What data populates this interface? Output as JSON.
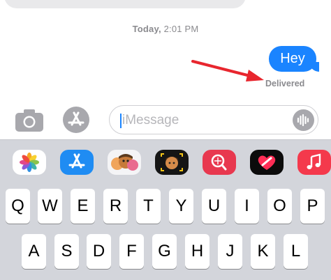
{
  "conversation": {
    "timestamp_day": "Today,",
    "timestamp_time": "2:01 PM",
    "sent_message": "Hey",
    "delivery_status": "Delivered"
  },
  "composer": {
    "placeholder": "iMessage"
  },
  "app_strip": {
    "apps": [
      {
        "icon": "photos-icon"
      },
      {
        "icon": "app-store-icon"
      },
      {
        "icon": "memoji-stickers-icon"
      },
      {
        "icon": "animoji-icon"
      },
      {
        "icon": "images-search-icon"
      },
      {
        "icon": "digital-touch-icon"
      },
      {
        "icon": "music-icon"
      }
    ]
  },
  "keyboard": {
    "row1": [
      "Q",
      "W",
      "E",
      "R",
      "T",
      "Y",
      "U",
      "I",
      "O",
      "P"
    ],
    "row2": [
      "A",
      "S",
      "D",
      "F",
      "G",
      "H",
      "J",
      "K",
      "L"
    ]
  },
  "colors": {
    "imessage_blue": "#1a84ff",
    "annotation_red": "#e8262e",
    "keyboard_bg": "#d3d5db"
  }
}
